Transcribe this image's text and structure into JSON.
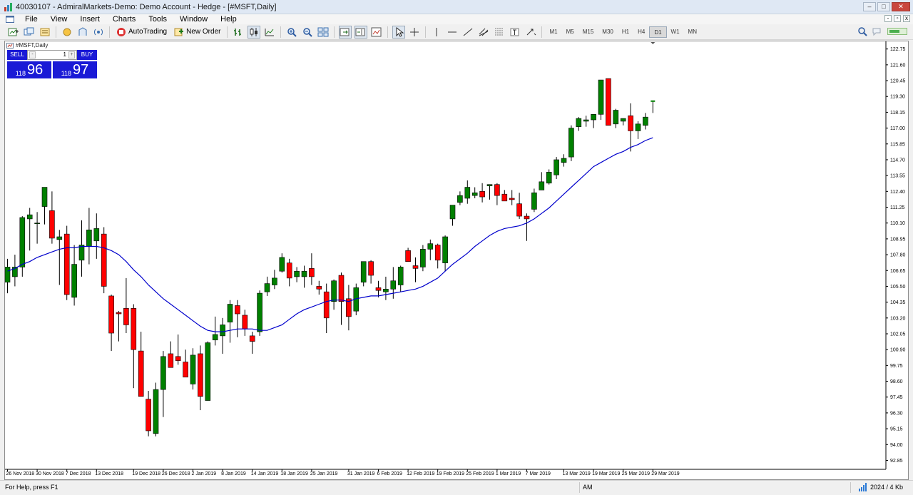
{
  "window": {
    "title": "40030107 - AdmiralMarkets-Demo: Demo Account - Hedge - [#MSFT,Daily]"
  },
  "menu": [
    "File",
    "View",
    "Insert",
    "Charts",
    "Tools",
    "Window",
    "Help"
  ],
  "toolbar": {
    "autotrading_label": "AutoTrading",
    "neworder_label": "New Order",
    "timeframes": [
      "M1",
      "M5",
      "M15",
      "M30",
      "H1",
      "H4",
      "D1",
      "W1",
      "MN"
    ],
    "active_timeframe": "D1"
  },
  "chart": {
    "caption": "#MSFT,Daily",
    "colors": {
      "bull": "#008000",
      "bear": "#ff0000",
      "ma": "#0000cc",
      "axis": "#000000"
    }
  },
  "trade_panel": {
    "sell_label": "SELL",
    "buy_label": "BUY",
    "lot": "1",
    "bid_prefix": "118",
    "bid_big": "96",
    "ask_prefix": "118",
    "ask_big": "97"
  },
  "status": {
    "help": "For Help, press F1",
    "mode": "AM",
    "traffic": "2024 / 4 Kb"
  },
  "chart_data": {
    "type": "candlestick",
    "ylim": [
      92.2,
      123.2
    ],
    "price_ticks": [
      "122.75",
      "121.60",
      "120.45",
      "119.30",
      "118.15",
      "117.00",
      "115.85",
      "114.70",
      "113.55",
      "112.40",
      "111.25",
      "110.10",
      "108.95",
      "107.80",
      "106.65",
      "105.50",
      "104.35",
      "103.20",
      "102.05",
      "100.90",
      "99.75",
      "98.60",
      "97.45",
      "96.30",
      "95.15",
      "94.00",
      "92.85"
    ],
    "date_labels": [
      "26 Nov 2018",
      "30 Nov 2018",
      "7 Dec 2018",
      "13 Dec 2018",
      "19 Dec 2018",
      "26 Dec 2018",
      "2 Jan 2019",
      "8 Jan 2019",
      "14 Jan 2019",
      "18 Jan 2019",
      "25 Jan 2019",
      "31 Jan 2019",
      "6 Feb 2019",
      "12 Feb 2019",
      "19 Feb 2019",
      "25 Feb 2019",
      "1 Mar 2019",
      "7 Mar 2019",
      "13 Mar 2019",
      "19 Mar 2019",
      "25 Mar 2019",
      "29 Mar 2019"
    ],
    "candles": [
      [
        105.8,
        107.5,
        105.0,
        106.9
      ],
      [
        106.2,
        107.8,
        105.5,
        106.9
      ],
      [
        106.9,
        110.6,
        106.2,
        110.5
      ],
      [
        110.4,
        111.2,
        108.1,
        110.7
      ],
      [
        110.1,
        110.9,
        108.6,
        110.1
      ],
      [
        111.3,
        112.5,
        110.0,
        112.7
      ],
      [
        111.0,
        112.4,
        108.6,
        109.0
      ],
      [
        108.9,
        109.6,
        105.6,
        109.1
      ],
      [
        109.3,
        109.9,
        104.5,
        104.9
      ],
      [
        104.7,
        108.5,
        104.1,
        107.1
      ],
      [
        107.4,
        110.3,
        106.2,
        108.5
      ],
      [
        108.4,
        111.2,
        107.1,
        109.6
      ],
      [
        108.8,
        110.8,
        107.5,
        109.7
      ],
      [
        109.3,
        109.8,
        105.0,
        105.5
      ],
      [
        104.8,
        104.9,
        100.8,
        102.1
      ],
      [
        103.6,
        103.7,
        101.5,
        103.5
      ],
      [
        103.9,
        106.1,
        102.1,
        102.7
      ],
      [
        103.9,
        104.2,
        98.1,
        100.9
      ],
      [
        100.8,
        102.2,
        97.5,
        97.5
      ],
      [
        97.3,
        97.9,
        94.6,
        95.0
      ],
      [
        94.8,
        98.5,
        94.6,
        98.0
      ],
      [
        98.0,
        100.8,
        96.0,
        100.4
      ],
      [
        100.6,
        101.5,
        99.6,
        99.6
      ],
      [
        100.4,
        102.0,
        99.8,
        100.1
      ],
      [
        100.0,
        100.9,
        99.3,
        98.9
      ],
      [
        98.4,
        101.0,
        98.0,
        100.5
      ],
      [
        100.6,
        101.2,
        96.5,
        97.5
      ],
      [
        97.2,
        101.5,
        97.2,
        101.4
      ],
      [
        101.6,
        103.3,
        101.2,
        102.0
      ],
      [
        101.9,
        103.2,
        100.6,
        102.7
      ],
      [
        102.9,
        104.5,
        101.4,
        104.2
      ],
      [
        104.1,
        104.5,
        101.8,
        103.5
      ],
      [
        103.4,
        103.8,
        101.9,
        102.4
      ],
      [
        101.9,
        102.2,
        100.6,
        101.5
      ],
      [
        102.2,
        105.2,
        101.9,
        105.0
      ],
      [
        105.1,
        106.2,
        104.8,
        105.7
      ],
      [
        105.6,
        106.7,
        105.3,
        106.1
      ],
      [
        106.6,
        107.9,
        106.5,
        107.6
      ],
      [
        107.2,
        107.5,
        105.5,
        106.1
      ],
      [
        106.2,
        106.9,
        105.8,
        106.6
      ],
      [
        106.2,
        107.0,
        105.4,
        106.6
      ],
      [
        106.8,
        107.9,
        105.6,
        106.2
      ],
      [
        105.5,
        105.9,
        104.9,
        105.3
      ],
      [
        105.1,
        105.7,
        102.1,
        103.2
      ],
      [
        104.4,
        106.0,
        103.8,
        105.9
      ],
      [
        106.3,
        106.5,
        102.7,
        104.4
      ],
      [
        104.6,
        105.6,
        102.3,
        103.3
      ],
      [
        103.7,
        105.7,
        103.4,
        105.4
      ],
      [
        105.8,
        107.3,
        105.5,
        107.3
      ],
      [
        107.3,
        107.4,
        105.7,
        106.3
      ],
      [
        105.4,
        105.9,
        104.7,
        105.2
      ],
      [
        105.1,
        106.2,
        104.5,
        105.3
      ],
      [
        105.3,
        106.9,
        104.6,
        105.9
      ],
      [
        105.6,
        107.0,
        105.1,
        106.9
      ],
      [
        108.1,
        108.3,
        107.5,
        107.3
      ],
      [
        107.0,
        107.6,
        105.8,
        106.8
      ],
      [
        106.9,
        108.5,
        106.6,
        108.2
      ],
      [
        108.2,
        108.9,
        107.4,
        108.6
      ],
      [
        108.5,
        108.6,
        106.8,
        107.4
      ],
      [
        107.2,
        109.2,
        106.6,
        109.1
      ],
      [
        110.4,
        111.2,
        109.9,
        111.4
      ],
      [
        111.6,
        112.4,
        111.4,
        112.1
      ],
      [
        111.9,
        113.2,
        111.5,
        112.7
      ],
      [
        112.1,
        112.7,
        111.9,
        112.3
      ],
      [
        112.4,
        113.0,
        111.6,
        112.0
      ],
      [
        112.8,
        112.9,
        111.8,
        112.9
      ],
      [
        112.9,
        113.0,
        111.4,
        112.1
      ],
      [
        112.2,
        112.5,
        111.7,
        111.7
      ],
      [
        111.9,
        112.5,
        111.4,
        111.8
      ],
      [
        111.5,
        112.3,
        110.4,
        110.6
      ],
      [
        110.6,
        110.8,
        108.8,
        110.4
      ],
      [
        111.1,
        112.6,
        110.9,
        112.3
      ],
      [
        112.5,
        113.8,
        112.5,
        113.1
      ],
      [
        113.0,
        114.0,
        112.9,
        113.8
      ],
      [
        113.6,
        114.9,
        113.3,
        114.7
      ],
      [
        114.5,
        115.1,
        114.2,
        114.8
      ],
      [
        114.9,
        117.2,
        114.6,
        117.0
      ],
      [
        117.1,
        117.8,
        116.8,
        117.7
      ],
      [
        117.5,
        117.9,
        117.1,
        117.6
      ],
      [
        117.6,
        117.8,
        117.0,
        118.0
      ],
      [
        118.0,
        120.4,
        117.6,
        120.5
      ],
      [
        120.6,
        120.6,
        117.3,
        117.2
      ],
      [
        117.3,
        118.4,
        117.0,
        118.3
      ],
      [
        117.5,
        117.7,
        117.2,
        117.7
      ],
      [
        117.9,
        118.8,
        115.3,
        116.8
      ],
      [
        116.8,
        117.5,
        116.2,
        117.3
      ],
      [
        117.2,
        118.1,
        116.9,
        117.8
      ],
      [
        118.9,
        119.0,
        118.1,
        118.96
      ]
    ],
    "ma": [
      106.6,
      106.8,
      107.1,
      107.3,
      107.6,
      107.8,
      108.0,
      108.2,
      108.3,
      108.3,
      108.4,
      108.4,
      108.4,
      108.3,
      108.1,
      107.8,
      107.3,
      106.7,
      106.2,
      105.6,
      105.1,
      104.6,
      104.2,
      103.8,
      103.4,
      103.0,
      102.6,
      102.3,
      102.2,
      102.2,
      102.3,
      102.4,
      102.4,
      102.4,
      102.3,
      102.3,
      102.5,
      102.7,
      103.1,
      103.5,
      103.8,
      104.0,
      104.2,
      104.4,
      104.5,
      104.5,
      104.4,
      104.6,
      104.7,
      104.8,
      104.8,
      104.9,
      105.0,
      105.1,
      105.2,
      105.3,
      105.5,
      105.8,
      106.1,
      106.6,
      107.1,
      107.5,
      107.9,
      108.4,
      108.8,
      109.2,
      109.5,
      109.7,
      109.8,
      109.9,
      110.1,
      110.4,
      110.8,
      111.2,
      111.7,
      112.2,
      112.7,
      113.2,
      113.7,
      114.2,
      114.5,
      114.8,
      115.1,
      115.3,
      115.6,
      115.8,
      116.1,
      116.3
    ]
  }
}
